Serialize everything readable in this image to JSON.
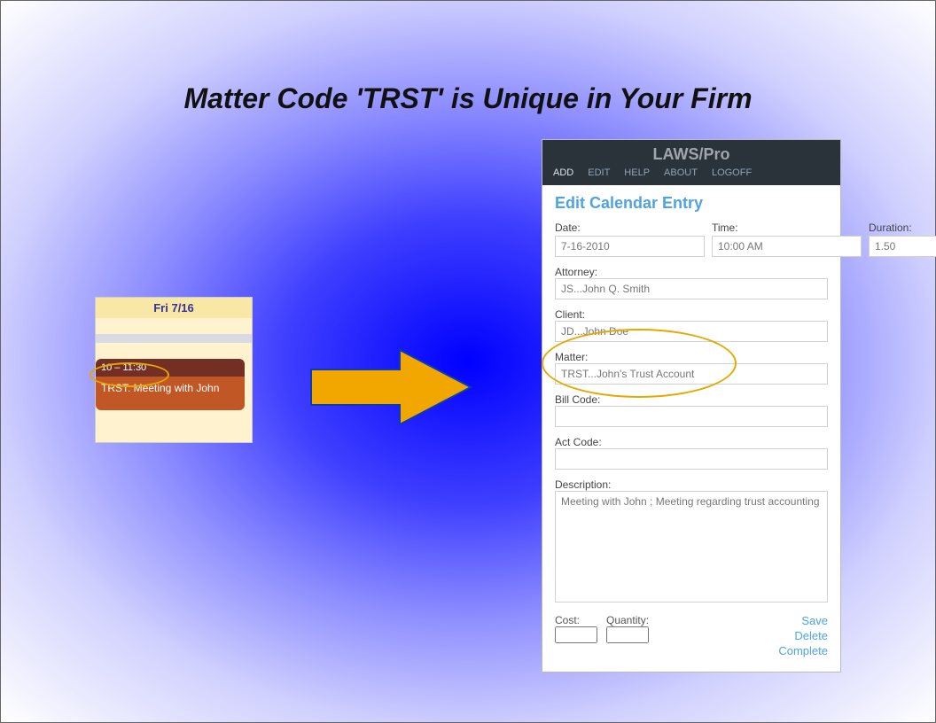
{
  "title": "Matter Code 'TRST' is Unique in Your Firm",
  "calendar": {
    "header": "Fri 7/16",
    "event_time": "10 – 11:30",
    "event_text": "TRST: Meeting with John"
  },
  "app": {
    "brand": "LAWS/Pro",
    "menu": [
      "ADD",
      "EDIT",
      "HELP",
      "ABOUT",
      "LOGOFF"
    ],
    "panel_heading": "Edit Calendar Entry",
    "fields": {
      "date_label": "Date:",
      "date_value": "7-16-2010",
      "time_label": "Time:",
      "time_value": "10:00 AM",
      "duration_label": "Duration:",
      "duration_value": "1.50",
      "attorney_label": "Attorney:",
      "attorney_value": "JS...John Q. Smith",
      "client_label": "Client:",
      "client_value": "JD...John Doe",
      "matter_label": "Matter:",
      "matter_value": "TRST...John's Trust Account",
      "billcode_label": "Bill Code:",
      "billcode_value": "",
      "actcode_label": "Act Code:",
      "actcode_value": "",
      "description_label": "Description:",
      "description_value": "Meeting with John ; Meeting regarding trust accounting",
      "cost_label": "Cost:",
      "cost_value": "",
      "quantity_label": "Quantity:",
      "quantity_value": ""
    },
    "actions": {
      "save": "Save",
      "delete": "Delete",
      "complete": "Complete"
    }
  }
}
